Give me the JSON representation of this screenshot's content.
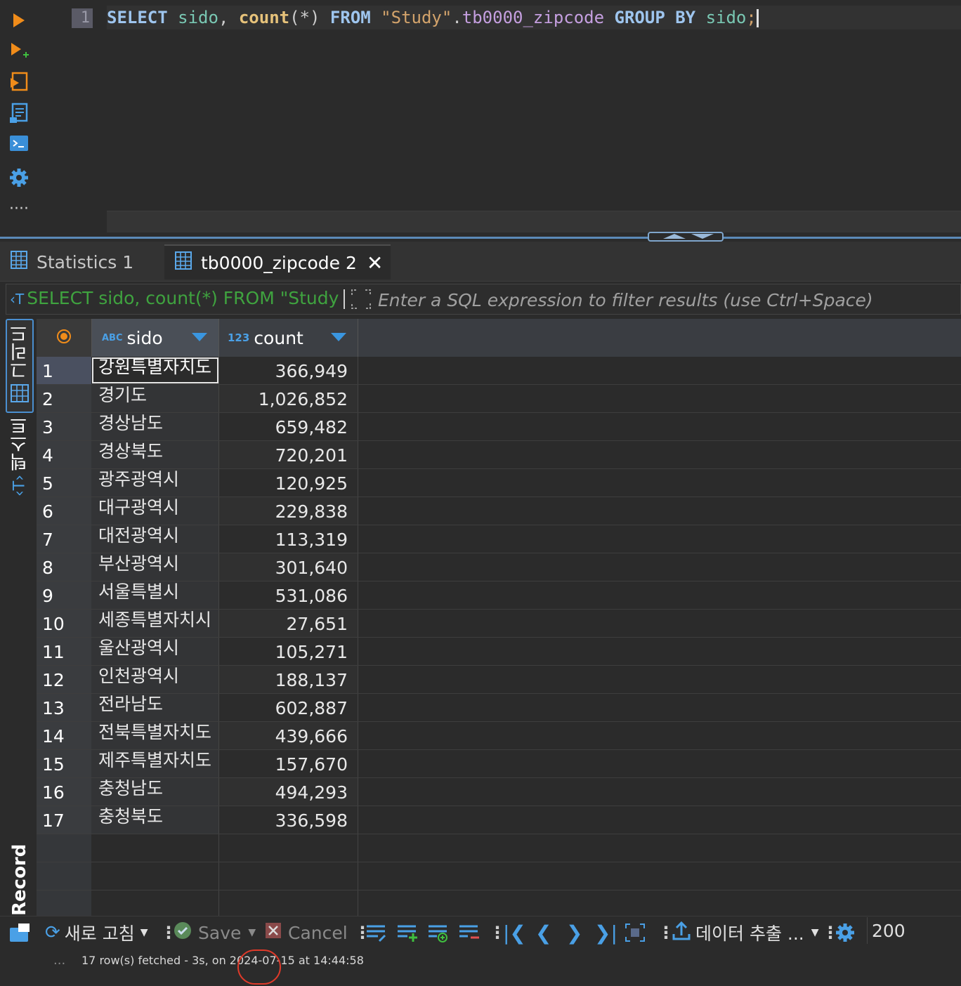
{
  "editor": {
    "line_number": "1",
    "sql_tokens": [
      {
        "t": "SELECT",
        "c": "kw"
      },
      {
        "t": " ",
        "c": "punc"
      },
      {
        "t": "sido",
        "c": "id"
      },
      {
        "t": ", ",
        "c": "punc"
      },
      {
        "t": "count",
        "c": "fn"
      },
      {
        "t": "(*)",
        "c": "punc"
      },
      {
        "t": " ",
        "c": "punc"
      },
      {
        "t": "FROM",
        "c": "kw"
      },
      {
        "t": " ",
        "c": "punc"
      },
      {
        "t": "\"Study\"",
        "c": "str"
      },
      {
        "t": ".",
        "c": "punc"
      },
      {
        "t": "tb0000_zipcode",
        "c": "tbl"
      },
      {
        "t": " ",
        "c": "punc"
      },
      {
        "t": "GROUP BY",
        "c": "kw"
      },
      {
        "t": " ",
        "c": "punc"
      },
      {
        "t": "sido",
        "c": "id"
      },
      {
        "t": ";",
        "c": "str"
      }
    ]
  },
  "tabs": [
    {
      "label": "Statistics 1"
    },
    {
      "label": "tb0000_zipcode 2",
      "close": "✕"
    }
  ],
  "filter": {
    "query_preview": "SELECT sido, count(*) FROM \"Study",
    "placeholder": "Enter a SQL expression to filter results (use Ctrl+Space)"
  },
  "side_tabs": {
    "grid": "그리드",
    "text": "텍스트",
    "record": "Record"
  },
  "grid": {
    "columns": [
      {
        "name": "sido",
        "type_badge": "ABC"
      },
      {
        "name": "count",
        "type_badge": "123"
      }
    ],
    "rows": [
      {
        "num": "1",
        "sido": "강원특별자치도",
        "count": "366,949"
      },
      {
        "num": "2",
        "sido": "경기도",
        "count": "1,026,852"
      },
      {
        "num": "3",
        "sido": "경상남도",
        "count": "659,482"
      },
      {
        "num": "4",
        "sido": "경상북도",
        "count": "720,201"
      },
      {
        "num": "5",
        "sido": "광주광역시",
        "count": "120,925"
      },
      {
        "num": "6",
        "sido": "대구광역시",
        "count": "229,838"
      },
      {
        "num": "7",
        "sido": "대전광역시",
        "count": "113,319"
      },
      {
        "num": "8",
        "sido": "부산광역시",
        "count": "301,640"
      },
      {
        "num": "9",
        "sido": "서울특별시",
        "count": "531,086"
      },
      {
        "num": "10",
        "sido": "세종특별자치시",
        "count": "27,651"
      },
      {
        "num": "11",
        "sido": "울산광역시",
        "count": "105,271"
      },
      {
        "num": "12",
        "sido": "인천광역시",
        "count": "188,137"
      },
      {
        "num": "13",
        "sido": "전라남도",
        "count": "602,887"
      },
      {
        "num": "14",
        "sido": "전북특별자치도",
        "count": "439,666"
      },
      {
        "num": "15",
        "sido": "제주특별자치도",
        "count": "157,670"
      },
      {
        "num": "16",
        "sido": "충청남도",
        "count": "494,293"
      },
      {
        "num": "17",
        "sido": "충청북도",
        "count": "336,598"
      }
    ]
  },
  "toolbar": {
    "refresh_label": "새로 고침",
    "save_label": "Save",
    "cancel_label": "Cancel",
    "export_label": "데이터 추출 ...",
    "fetch_size": "200"
  },
  "status": {
    "prefix": "17 row(s) fetched - ",
    "duration": "3s,",
    "suffix": " on 2024-07-15 at 14:44:58"
  },
  "colors": {
    "accent": "#3a96e0",
    "highlight": "#e03a2a",
    "sql_green": "#3fa33f"
  }
}
